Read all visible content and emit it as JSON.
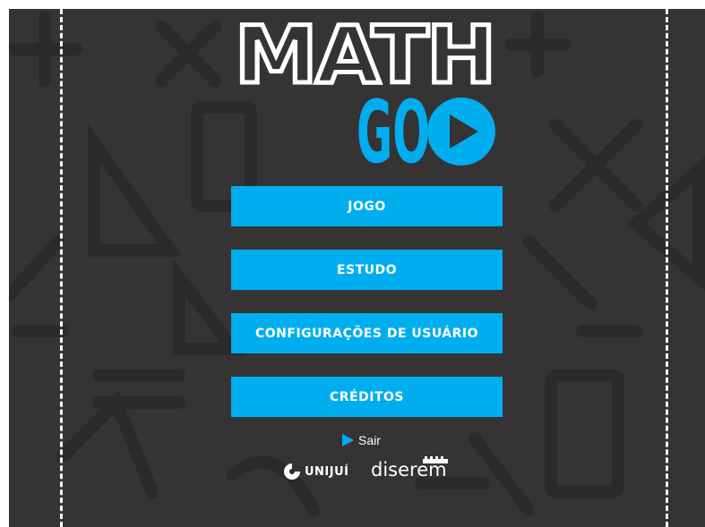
{
  "app": {
    "logo_line1": "MATH",
    "logo_line2": "GO"
  },
  "menu": {
    "items": [
      {
        "label": "JOGO"
      },
      {
        "label": "ESTUDO"
      },
      {
        "label": "CONFIGURAÇÕES DE USUÁRIO"
      },
      {
        "label": "CRÉDITOS"
      }
    ]
  },
  "exit": {
    "label": "Sair",
    "icon": "play-triangle-icon"
  },
  "sponsors": {
    "unijui": "UNIJUÍ",
    "diserem": "diserem"
  },
  "colors": {
    "background": "#353334",
    "accent": "#00aeef",
    "text": "#ffffff"
  }
}
